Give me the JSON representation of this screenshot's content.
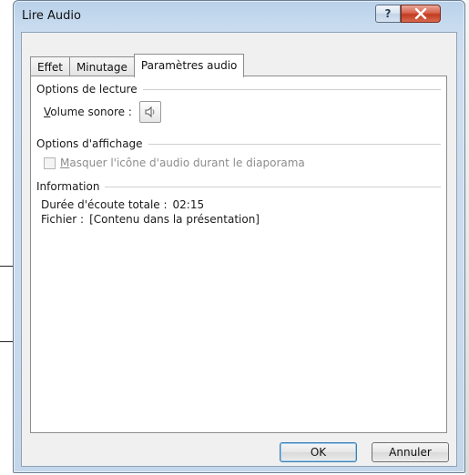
{
  "window": {
    "title": "Lire Audio",
    "help_label": "?",
    "close_label": "Fermer"
  },
  "tabs": [
    {
      "label": "Effet",
      "active": false
    },
    {
      "label": "Minutage",
      "active": false
    },
    {
      "label": "Paramètres audio",
      "active": true
    }
  ],
  "playback": {
    "group_label": "Options de lecture",
    "volume_label_accel": "V",
    "volume_label_rest": "olume sonore :",
    "volume_icon": "speaker-icon"
  },
  "display": {
    "group_label": "Options d'affichage",
    "hide_icon_accel": "M",
    "hide_icon_rest": "asquer l'icône d'audio durant le diaporama",
    "hide_icon_checked": false,
    "hide_icon_enabled": false
  },
  "information": {
    "group_label": "Information",
    "duration_label": "Durée d'écoute totale :",
    "duration_value": "02:15",
    "file_label": "Fichier :",
    "file_value": "[Contenu dans la présentation]"
  },
  "buttons": {
    "ok_label": "OK",
    "cancel_label": "Annuler"
  },
  "colors": {
    "title_bar": "#c9dcef",
    "close_button": "#c23a1f",
    "default_button_border": "#3c7fb1"
  }
}
